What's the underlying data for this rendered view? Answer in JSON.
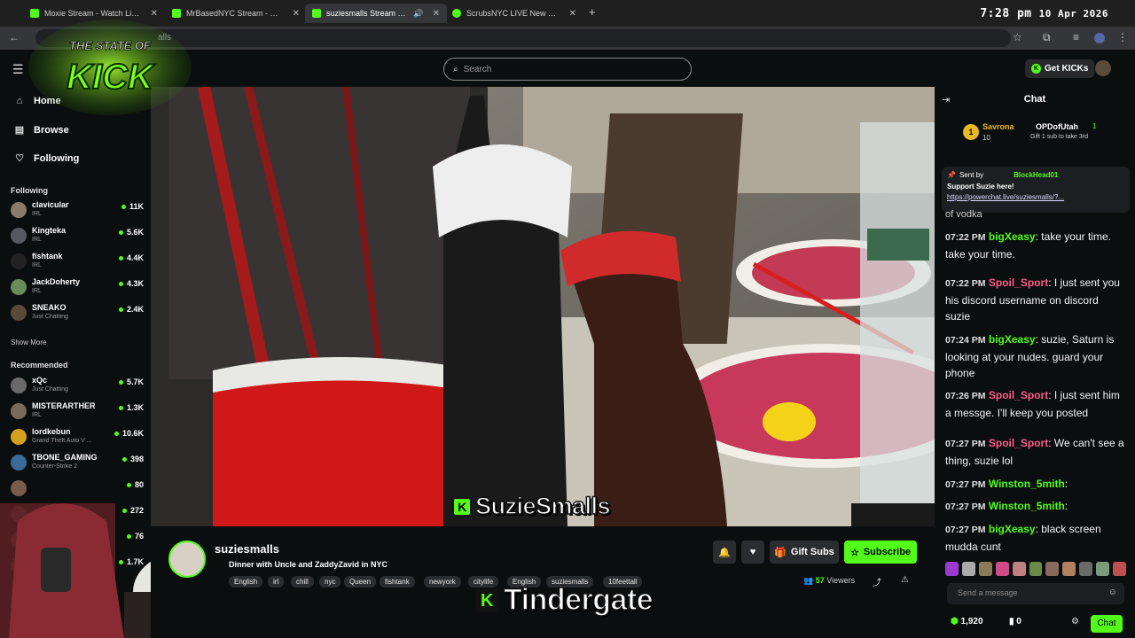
{
  "browser": {
    "tabs": [
      {
        "title": "Moxie Stream - Watch Live on Kick",
        "favicon_color": "#53fc18"
      },
      {
        "title": "MrBasedNYC Stream - Watch Live",
        "favicon_color": "#53fc18"
      },
      {
        "title": "suziesmalls Stream - Watch Live",
        "favicon_color": "#53fc18"
      },
      {
        "title": "ScrubsNYC LIVE New York City",
        "favicon_color": "#53fc18"
      }
    ],
    "new_tab": "+",
    "time": "7:28 pm",
    "date": "10 Apr 2026",
    "url_fragment": "alls"
  },
  "logo": {
    "top": "THE STATE OF",
    "main": "KICK"
  },
  "header": {
    "search_placeholder": "Search",
    "get_kicks": "Get KICKs"
  },
  "sidebar": {
    "nav": [
      {
        "label": "Home",
        "icon": "home-icon"
      },
      {
        "label": "Browse",
        "icon": "browse-icon"
      },
      {
        "label": "Following",
        "icon": "heart-icon"
      }
    ],
    "following_title": "Following",
    "following": [
      {
        "name": "clavicular",
        "category": "IRL",
        "viewers": "11K",
        "color": "#8a7a6a"
      },
      {
        "name": "Kingteka",
        "category": "IRL",
        "viewers": "5.6K",
        "color": "#555a60"
      },
      {
        "name": "fishtank",
        "category": "IRL",
        "viewers": "4.4K",
        "color": "#222222"
      },
      {
        "name": "JackDoherty",
        "category": "IRL",
        "viewers": "4.3K",
        "color": "#6a8a5a"
      },
      {
        "name": "SNEAKO",
        "category": "Just Chatting",
        "viewers": "2.4K",
        "color": "#5a4a3a"
      }
    ],
    "show_more": "Show More",
    "recommended_title": "Recommended",
    "recommended": [
      {
        "name": "xQc",
        "category": "Just Chatting",
        "viewers": "5.7K",
        "color": "#6a6a6a"
      },
      {
        "name": "MISTERARTHER",
        "category": "IRL",
        "viewers": "1.3K",
        "color": "#7a6a5a"
      },
      {
        "name": "lordkebun",
        "category": "Grand Theft Auto V ...",
        "viewers": "10.6K",
        "color": "#d4a020"
      },
      {
        "name": "TBONE_GAMING",
        "category": "Counter-Strike 2",
        "viewers": "398",
        "color": "#3a6a9a"
      },
      {
        "name": "",
        "category": "",
        "viewers": "80",
        "color": "#7a5a4a"
      },
      {
        "name": "",
        "category": "",
        "viewers": "272",
        "color": "#7a5a4a"
      },
      {
        "name": "",
        "category": "",
        "viewers": "76",
        "color": "#7a5a4a"
      },
      {
        "name": "",
        "category": "",
        "viewers": "1.7K",
        "color": "#7a5a4a"
      }
    ]
  },
  "overlay": {
    "name": "SuzieSmalls",
    "caption": "Tindergate"
  },
  "stream": {
    "streamer": "suziesmalls",
    "title": "Dinner with Uncle and ZaddyZavid in NYC",
    "tags": [
      "English",
      "irl",
      "chill",
      "nyc",
      "Queen",
      "fishtank",
      "newyork",
      "citylife",
      "English",
      "suziesmalls",
      "10feettall"
    ],
    "viewers": "57",
    "viewers_label": "Viewers",
    "gift_subs": "Gift Subs",
    "subscribe": "Subscribe"
  },
  "chat": {
    "title": "Chat",
    "pinned_top": {
      "rank": "1",
      "user": "Savrona",
      "count": "10",
      "user2": "OPDofUtah",
      "count2": "1",
      "note": "Gift 1 sub to take 3rd"
    },
    "pinned": {
      "sent_by": "Sent by",
      "user": "BlockHead01",
      "text": "Support Suzie here!",
      "link": "https://powerchat.live/suziesmalls/?..."
    },
    "partial_line": "of vodka",
    "messages": [
      {
        "time": "07:22 PM",
        "user": "bigXeasy",
        "color": "green",
        "text": "take your time. take your time."
      },
      {
        "time": "07:22 PM",
        "user": "Spoil_Sport",
        "color": "pink",
        "text": "I just sent you his discord username on discord suzie"
      },
      {
        "time": "07:24 PM",
        "user": "bigXeasy",
        "color": "green",
        "text": "suzie, Saturn is looking at your nudes. guard your phone"
      },
      {
        "time": "07:26 PM",
        "user": "Spoil_Sport",
        "color": "pink",
        "text": "I just sent him a messge. I'll keep you posted"
      },
      {
        "time": "07:27 PM",
        "user": "Spoil_Sport",
        "color": "pink",
        "text": "We can't see a thing, suzie lol"
      },
      {
        "time": "07:27 PM",
        "user": "Winston_5mith",
        "color": "green",
        "text": ""
      },
      {
        "time": "07:27 PM",
        "user": "Winston_5mith",
        "color": "green",
        "text": ""
      },
      {
        "time": "07:27 PM",
        "user": "bigXeasy",
        "color": "green",
        "text": "black screen mudda cunt"
      }
    ],
    "input_placeholder": "Send a message",
    "kicks": "1,920",
    "zero": "0",
    "send": "Chat"
  }
}
